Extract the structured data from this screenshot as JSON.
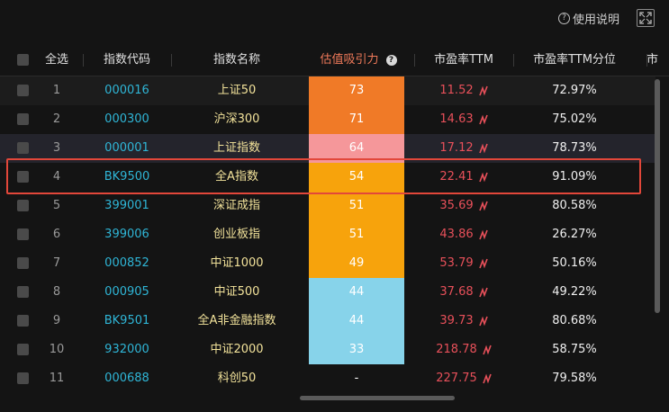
{
  "topbar": {
    "help_label": "使用说明",
    "help_icon": "?"
  },
  "header": {
    "select_all": "全选",
    "code": "指数代码",
    "name": "指数名称",
    "attractiveness": "估值吸引力",
    "attractiveness_help": "?",
    "pe": "市盈率TTM",
    "pe_percentile": "市盈率TTM分位",
    "truncated": "市"
  },
  "colors": {
    "orange": "#f07a27",
    "salmon": "#f5979a",
    "amber": "#f7a30c",
    "lightblue": "#87d3ea",
    "highlight_border": "#e2473a"
  },
  "rows": [
    {
      "no": "1",
      "code": "000016",
      "name": "上证50",
      "score": "73",
      "score_color": "orange",
      "pe": "11.52",
      "pct": "72.97%"
    },
    {
      "no": "2",
      "code": "000300",
      "name": "沪深300",
      "score": "71",
      "score_color": "orange",
      "pe": "14.63",
      "pct": "75.02%"
    },
    {
      "no": "3",
      "code": "000001",
      "name": "上证指数",
      "score": "64",
      "score_color": "salmon",
      "pe": "17.12",
      "pct": "78.73%"
    },
    {
      "no": "4",
      "code": "BK9500",
      "name": "全A指数",
      "score": "54",
      "score_color": "amber",
      "pe": "22.41",
      "pct": "91.09%"
    },
    {
      "no": "5",
      "code": "399001",
      "name": "深证成指",
      "score": "51",
      "score_color": "amber",
      "pe": "35.69",
      "pct": "80.58%"
    },
    {
      "no": "6",
      "code": "399006",
      "name": "创业板指",
      "score": "51",
      "score_color": "amber",
      "pe": "43.86",
      "pct": "26.27%"
    },
    {
      "no": "7",
      "code": "000852",
      "name": "中证1000",
      "score": "49",
      "score_color": "amber",
      "pe": "53.79",
      "pct": "50.16%"
    },
    {
      "no": "8",
      "code": "000905",
      "name": "中证500",
      "score": "44",
      "score_color": "lightblue",
      "pe": "37.68",
      "pct": "49.22%"
    },
    {
      "no": "9",
      "code": "BK9501",
      "name": "全A非金融指数",
      "score": "44",
      "score_color": "lightblue",
      "pe": "39.73",
      "pct": "80.68%"
    },
    {
      "no": "10",
      "code": "932000",
      "name": "中证2000",
      "score": "33",
      "score_color": "lightblue",
      "pe": "218.78",
      "pct": "58.75%"
    },
    {
      "no": "11",
      "code": "000688",
      "name": "科创50",
      "score": "-",
      "score_color": "none",
      "pe": "227.75",
      "pct": "79.58%"
    }
  ]
}
